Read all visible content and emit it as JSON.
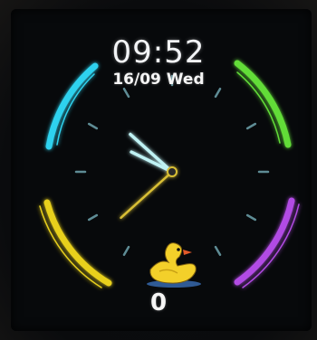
{
  "watch": {
    "time_display": "09:52",
    "hours": "09",
    "minutes": "52",
    "date_display": "16/09 Wed",
    "step_count": "0"
  },
  "analog": {
    "hour": 9,
    "minute": 52,
    "second": 38
  },
  "colors": {
    "arc_top_left": "#2fd2ef",
    "arc_top_right": "#62dc38",
    "arc_bottom_left": "#e8d01e",
    "arc_bottom_right": "#b24be4",
    "hands": "#bff2f4",
    "second_hand": "#d9bf35",
    "ticks": "#5e8c95"
  },
  "icons": {
    "mascot": "rubber-duck-icon"
  }
}
